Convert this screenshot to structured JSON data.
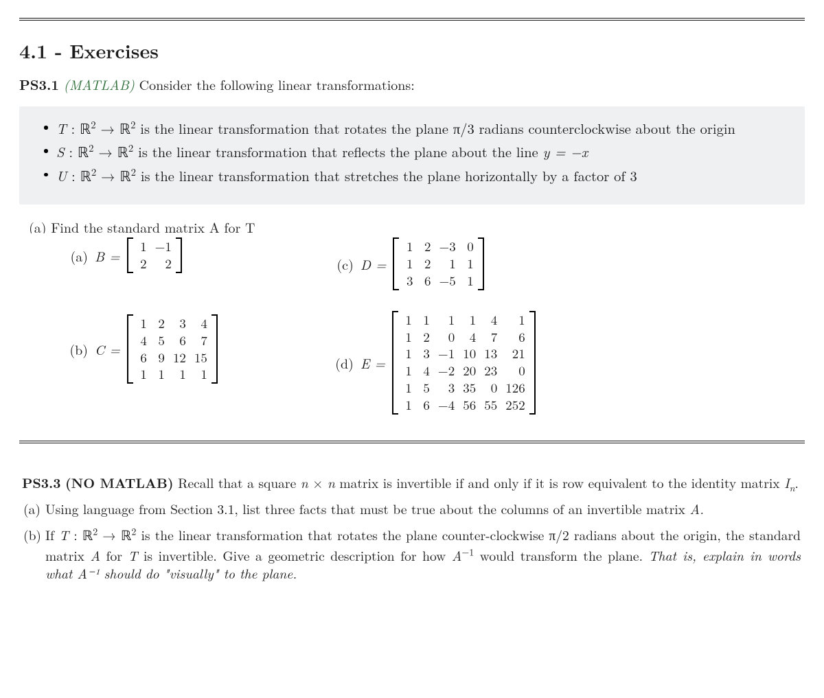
{
  "section_title": "4.1 - Exercises",
  "ps31": {
    "id": "PS3.1",
    "tag": "(MATLAB)",
    "prompt": "Consider the following linear transformations:",
    "defs": {
      "t": " is the linear transformation that rotates the plane π/3 radians counterclockwise about the origin",
      "s": " is the linear transformation that reflects the plane about the line ",
      "s_eq": "y = −x",
      "u": " is the linear transformation that stretches the plane horizontally by a factor of 3"
    },
    "truncated_line": "(a) Find the standard matrix A for T",
    "items": {
      "a": {
        "label": "(a)",
        "name": "B",
        "rows": [
          [
            "1",
            "−1"
          ],
          [
            "2",
            "2"
          ]
        ]
      },
      "b": {
        "label": "(b)",
        "name": "C",
        "rows": [
          [
            "1",
            "2",
            "3",
            "4"
          ],
          [
            "4",
            "5",
            "6",
            "7"
          ],
          [
            "6",
            "9",
            "12",
            "15"
          ],
          [
            "1",
            "1",
            "1",
            "1"
          ]
        ]
      },
      "c": {
        "label": "(c)",
        "name": "D",
        "rows": [
          [
            "1",
            "2",
            "−3",
            "0"
          ],
          [
            "1",
            "2",
            "1",
            "1"
          ],
          [
            "3",
            "6",
            "−5",
            "1"
          ]
        ]
      },
      "d": {
        "label": "(d)",
        "name": "E",
        "rows": [
          [
            "1",
            "1",
            "1",
            "1",
            "4",
            "1"
          ],
          [
            "1",
            "2",
            "0",
            "4",
            "7",
            "6"
          ],
          [
            "1",
            "3",
            "−1",
            "10",
            "13",
            "21"
          ],
          [
            "1",
            "4",
            "−2",
            "20",
            "23",
            "0"
          ],
          [
            "1",
            "5",
            "3",
            "35",
            "0",
            "126"
          ],
          [
            "1",
            "6",
            "−4",
            "56",
            "55",
            "252"
          ]
        ]
      }
    }
  },
  "ps33": {
    "id": "PS3.3",
    "tag": "(NO MATLAB)",
    "intro_pre": "Recall that a square ",
    "intro_mid": " matrix is invertible if and only if it is row equivalent to the identity matrix ",
    "intro_var": "Iₙ",
    "a_text": "Using language from Section 3.1, list three facts that must be true about the columns of an invertible matrix ",
    "a_var": "A.",
    "b_pre": "If ",
    "b_mid1": " is the linear transformation that rotates the plane counter-clockwise π/2 radians about the origin, the standard matrix ",
    "b_mid2": " for ",
    "b_mid3": " is invertible. Give a geometric description for how ",
    "b_mid4": " would transform the plane. ",
    "b_ital": "That is, explain in words what A⁻¹ should do \"visually\" to the plane."
  },
  "labels": {
    "a": "(a)",
    "b": "(b)"
  }
}
